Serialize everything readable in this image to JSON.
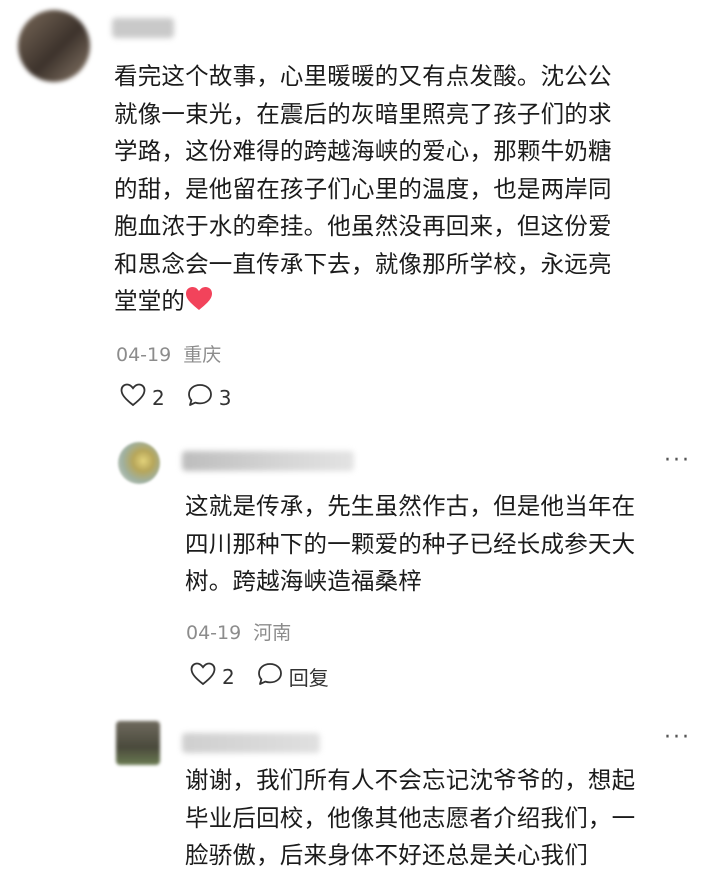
{
  "comment_1": {
    "lines": [
      "看完这个故事，心里暖暖的又有点发酸。沈公公",
      "就像一束光，在震后的灰暗里照亮了孩子们的求",
      "学路，这份难得的跨越海峡的爱心，那颗牛奶糖",
      "的甜，是他留在孩子们心里的温度，也是两岸同",
      "胞血浓于水的牵挂。他虽然没再回来，但这份爱",
      "和思念会一直传承下去，就像那所学校，永远亮",
      "堂堂的"
    ],
    "date": "04-19",
    "location": "重庆",
    "likes": "2",
    "replies": "3"
  },
  "reply_1": {
    "lines": [
      "这就是传承，先生虽然作古，但是他当年在",
      "四川那种下的一颗爱的种子已经长成参天大",
      "树。跨越海峡造福桑梓"
    ],
    "date": "04-19",
    "location": "河南",
    "likes": "2",
    "reply_label": "回复",
    "more": "···"
  },
  "reply_2": {
    "lines": [
      "谢谢，我们所有人不会忘记沈爷爷的，想起",
      "毕业后回校，他像其他志愿者介绍我们，一",
      "脸骄傲，后来身体不好还总是关心我们"
    ],
    "more": "···"
  },
  "colors": {
    "heart": "#f2435b",
    "meta": "#8c8c8c"
  },
  "icons": {
    "like": "heart-outline-icon",
    "comment": "chat-bubble-icon",
    "more": "more-dots-icon"
  }
}
